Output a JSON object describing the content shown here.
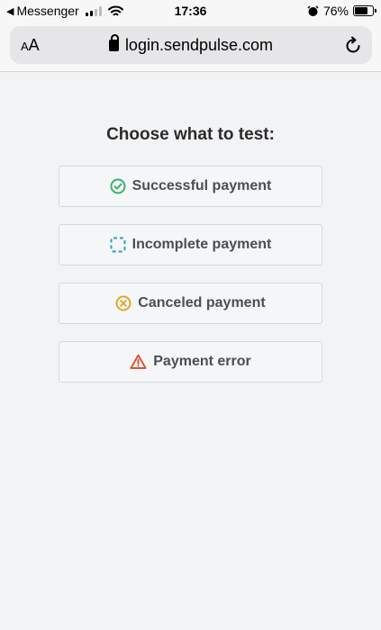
{
  "status_bar": {
    "back_app": "Messenger",
    "time": "17:36",
    "battery_percent": "76%",
    "battery_level": 0.76
  },
  "browser": {
    "text_size_label": "AA",
    "url": "login.sendpulse.com"
  },
  "page": {
    "heading": "Choose what to test:",
    "options": [
      {
        "label": "Successful payment",
        "icon": "check-circle-icon",
        "color": "#3ab36b"
      },
      {
        "label": "Incomplete payment",
        "icon": "dashed-square-icon",
        "color": "#2aa4b5"
      },
      {
        "label": "Canceled payment",
        "icon": "x-circle-icon",
        "color": "#e0a82e"
      },
      {
        "label": "Payment error",
        "icon": "warning-triangle-icon",
        "color": "#d5573b"
      }
    ]
  }
}
